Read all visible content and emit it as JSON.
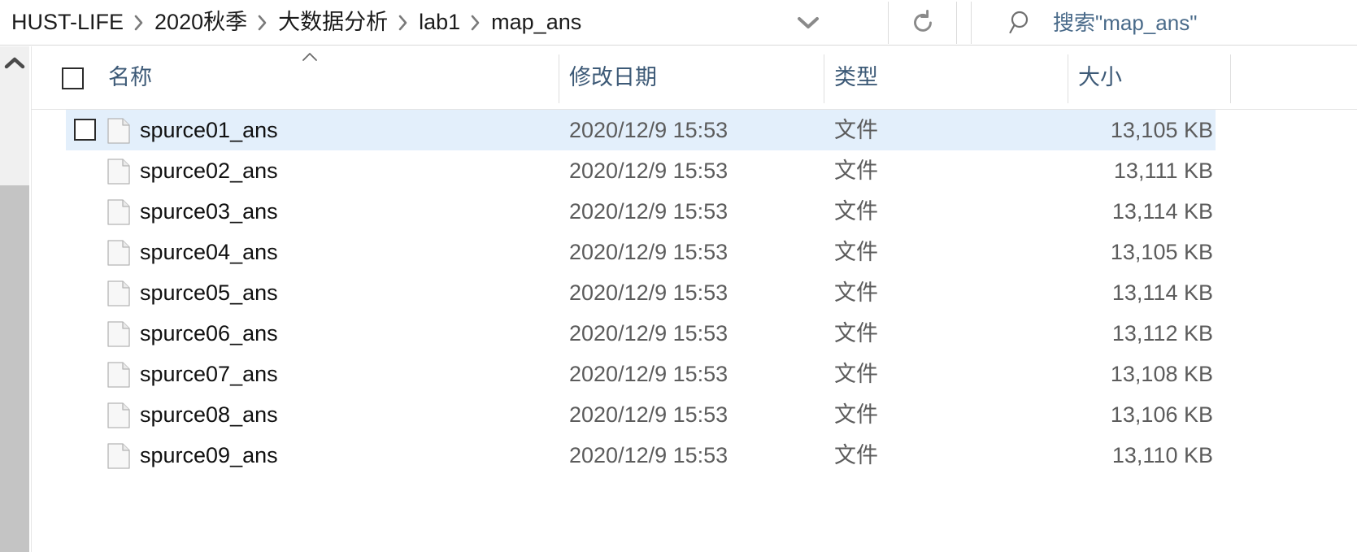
{
  "addressbar": {
    "breadcrumb": [
      {
        "label": "HUST-LIFE"
      },
      {
        "label": "2020秋季"
      },
      {
        "label": "大数据分析"
      },
      {
        "label": "lab1"
      },
      {
        "label": "map_ans"
      }
    ],
    "dropdown_icon": "chevron-down-icon",
    "refresh_icon": "refresh-icon",
    "search": {
      "icon": "search-icon",
      "placeholder": "搜索\"map_ans\"",
      "value": ""
    }
  },
  "filelist": {
    "columns": [
      {
        "key": "name",
        "label": "名称",
        "sorted": true,
        "sort_direction": "ascending"
      },
      {
        "key": "date",
        "label": "修改日期"
      },
      {
        "key": "type",
        "label": "类型"
      },
      {
        "key": "size",
        "label": "大小"
      }
    ],
    "select_all_checked": false,
    "rows": [
      {
        "name": "spurce01_ans",
        "date": "2020/12/9 15:53",
        "type": "文件",
        "size": "13,105 KB",
        "selected": true,
        "icon": "file-icon"
      },
      {
        "name": "spurce02_ans",
        "date": "2020/12/9 15:53",
        "type": "文件",
        "size": "13,111 KB",
        "selected": false,
        "icon": "file-icon"
      },
      {
        "name": "spurce03_ans",
        "date": "2020/12/9 15:53",
        "type": "文件",
        "size": "13,114 KB",
        "selected": false,
        "icon": "file-icon"
      },
      {
        "name": "spurce04_ans",
        "date": "2020/12/9 15:53",
        "type": "文件",
        "size": "13,105 KB",
        "selected": false,
        "icon": "file-icon"
      },
      {
        "name": "spurce05_ans",
        "date": "2020/12/9 15:53",
        "type": "文件",
        "size": "13,114 KB",
        "selected": false,
        "icon": "file-icon"
      },
      {
        "name": "spurce06_ans",
        "date": "2020/12/9 15:53",
        "type": "文件",
        "size": "13,112 KB",
        "selected": false,
        "icon": "file-icon"
      },
      {
        "name": "spurce07_ans",
        "date": "2020/12/9 15:53",
        "type": "文件",
        "size": "13,108 KB",
        "selected": false,
        "icon": "file-icon"
      },
      {
        "name": "spurce08_ans",
        "date": "2020/12/9 15:53",
        "type": "文件",
        "size": "13,106 KB",
        "selected": false,
        "icon": "file-icon"
      },
      {
        "name": "spurce09_ans",
        "date": "2020/12/9 15:53",
        "type": "文件",
        "size": "13,110 KB",
        "selected": false,
        "icon": "file-icon"
      }
    ]
  },
  "scrollbar": {
    "up_arrow_icon": "chevron-up-icon",
    "orientation": "vertical"
  },
  "colors": {
    "selection": "#e3effb",
    "header_text": "#3d5a77",
    "body_text": "#111111",
    "secondary_text": "#5c5c5c",
    "search_text": "#4a6b8a",
    "scrollbar_track": "#f0f0f0",
    "scrollbar_thumb": "#c4c4c4"
  }
}
